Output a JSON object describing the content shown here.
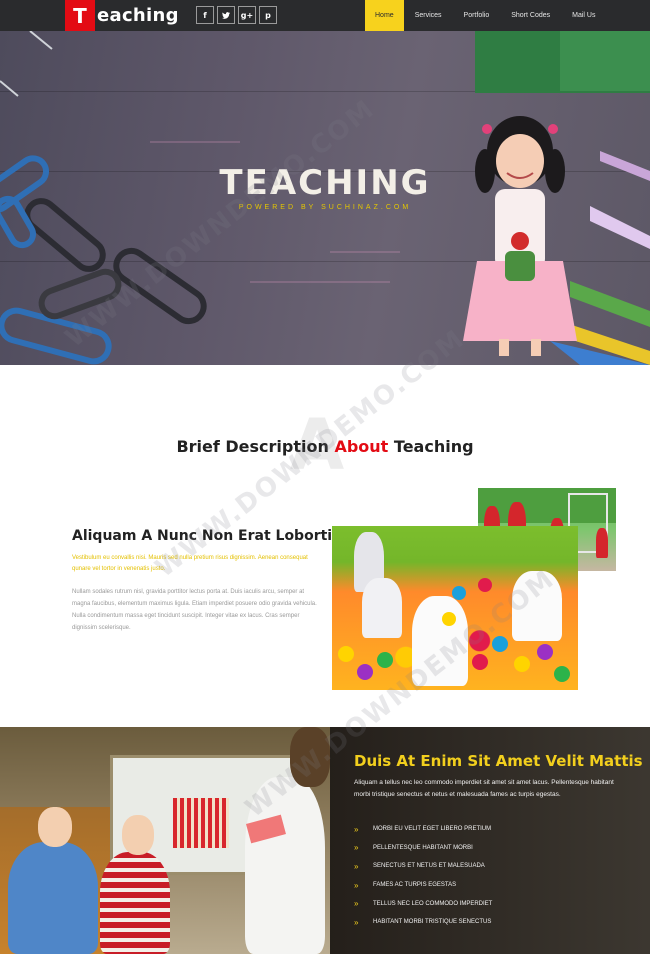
{
  "nav": {
    "logo_letter": "T",
    "logo_text": "eaching",
    "social": [
      "f",
      "t",
      "g+",
      "p"
    ],
    "social_icons": [
      "facebook-icon",
      "twitter-icon",
      "google-plus-icon",
      "pinterest-icon"
    ],
    "items": [
      "Home",
      "Services",
      "Portfolio",
      "Short Codes",
      "Mail Us"
    ],
    "active_item": "Home"
  },
  "hero": {
    "title": "TEACHING",
    "subtitle": "POWERED BY SUCHINAZ.COM"
  },
  "about": {
    "big_letter": "A",
    "title_before": "Brief Description",
    "title_highlight": "About",
    "title_after": "Teaching",
    "heading": "Aliquam A Nunc Non Erat Lobortis",
    "highlight_text": "Vestibulum eu convallis nisi. Mauris sed nulla pretium risus dignissim. Aenean consequat qunare vel tortor in venenatis justo.",
    "paragraph": "Nullam sodales rutrum nisl, gravida porttitor lectus porta at. Duis iaculis arcu, semper at magna faucibus, elementum maximus ligula. Etiam imperdiet posuere odio gravida vehicula. Nulla condimentum massa eget tincidunt suscipit. Integer vitae ex lacus. Cras semper dignissim scelerisque."
  },
  "feature": {
    "title": "Duis At Enim Sit Amet Velit Mattis",
    "text": "Aliquam a tellus nec leo commodo imperdiet sit amet sit amet lacus. Pellentesque habitant morbi tristique senectus et netus et malesuada fames ac turpis egestas.",
    "list": [
      "MORBI EU VELIT EGET LIBERO PRETIUM",
      "PELLENTESQUE HABITANT MORBI",
      "SENECTUS ET NETUS ET MALESUADA",
      "FAMES AC TURPIS EGESTAS",
      "TELLUS NEC LEO COMMODO IMPERDIET",
      "HABITANT MORBI TRISTIQUE SENECTUS"
    ]
  },
  "watermark": "WWW.DOWNDEMO.COM",
  "colors": {
    "accent_yellow": "#f7d21d",
    "brand_red": "#e30b14",
    "nav_bg": "#2a2b2d"
  }
}
